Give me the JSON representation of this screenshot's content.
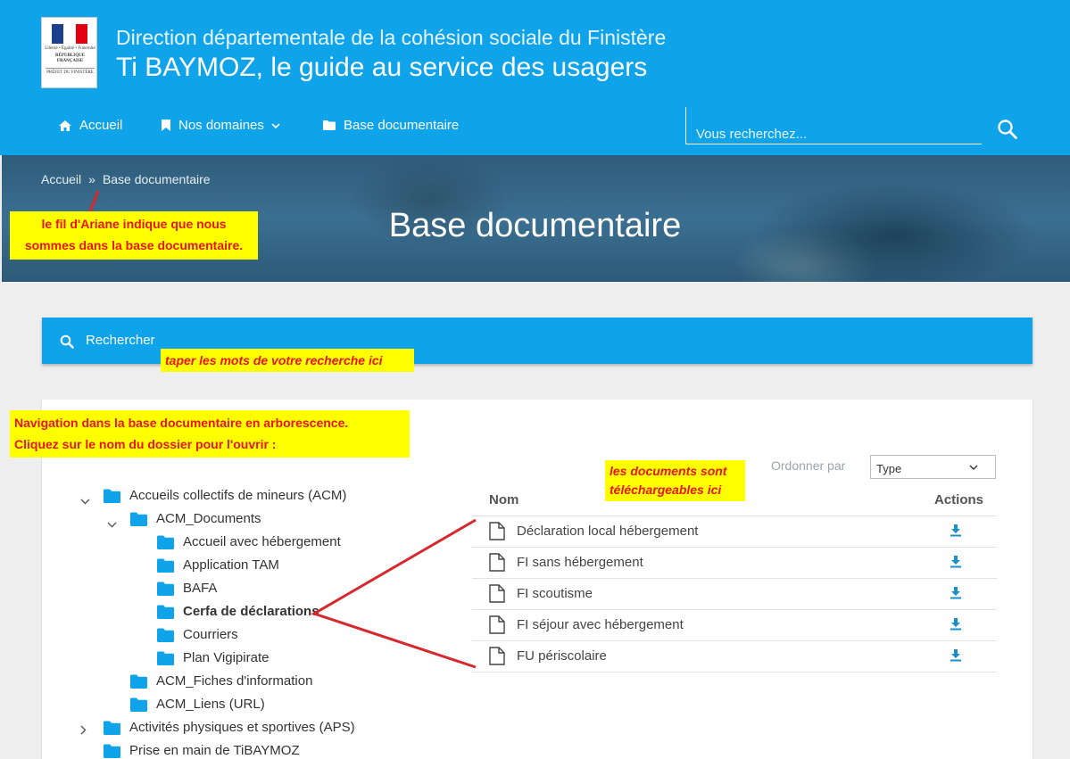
{
  "header": {
    "logo": {
      "line1": "Liberté • Égalité • Fraternité",
      "line2": "RÉPUBLIQUE FRANÇAISE",
      "line3": "PRÉFET DU FINISTÈRE"
    },
    "subtitle": "Direction départementale de la cohésion sociale du Finistère",
    "title": "Ti BAYMOZ, le guide au service des usagers"
  },
  "nav": {
    "home": "Accueil",
    "domains": "Nos domaines",
    "docbase": "Base documentaire",
    "search_placeholder": "Vous recherchez..."
  },
  "banner": {
    "breadcrumb": {
      "home": "Accueil",
      "sep": "»",
      "current": "Base documentaire"
    },
    "title": "Base documentaire"
  },
  "annotations": {
    "breadcrumb_note": [
      "le fil d'Ariane indique que nous",
      "sommes dans la base documentaire."
    ],
    "search_note": "taper les mots de votre recherche ici",
    "tree_note": [
      "Navigation dans la base documentaire en arborescence.",
      "Cliquez sur le nom du dossier pour l'ouvrir :"
    ],
    "docs_note": [
      "les documents sont",
      "téléchargeables ici"
    ]
  },
  "doc_search": {
    "label": "Rechercher"
  },
  "tree": [
    {
      "label": "Accueils collectifs de mineurs (ACM)"
    },
    {
      "label": "ACM_Documents"
    },
    {
      "label": "Accueil avec hébergement"
    },
    {
      "label": "Application TAM"
    },
    {
      "label": "BAFA"
    },
    {
      "label": "Cerfa de déclarations"
    },
    {
      "label": "Courriers"
    },
    {
      "label": "Plan Vigipirate"
    },
    {
      "label": "ACM_Fiches d'information"
    },
    {
      "label": "ACM_Liens (URL)"
    },
    {
      "label": "Activités physiques et sportives (APS)"
    },
    {
      "label": "Prise en main de TiBAYMOZ"
    }
  ],
  "sort": {
    "label": "Ordonner par",
    "value": "Type"
  },
  "table": {
    "col_name": "Nom",
    "col_actions": "Actions",
    "rows": [
      {
        "name": "Déclaration local hébergement"
      },
      {
        "name": "FI sans hébergement"
      },
      {
        "name": "FI scoutisme"
      },
      {
        "name": "FI séjour avec hébergement"
      },
      {
        "name": "FU périscolaire"
      }
    ]
  },
  "colors": {
    "primary": "#0fa3ea",
    "folder": "#0fa3ea",
    "annotation_bg": "#ffff00",
    "annotation_text": "#e8141b",
    "arrow": "#d9272e"
  }
}
